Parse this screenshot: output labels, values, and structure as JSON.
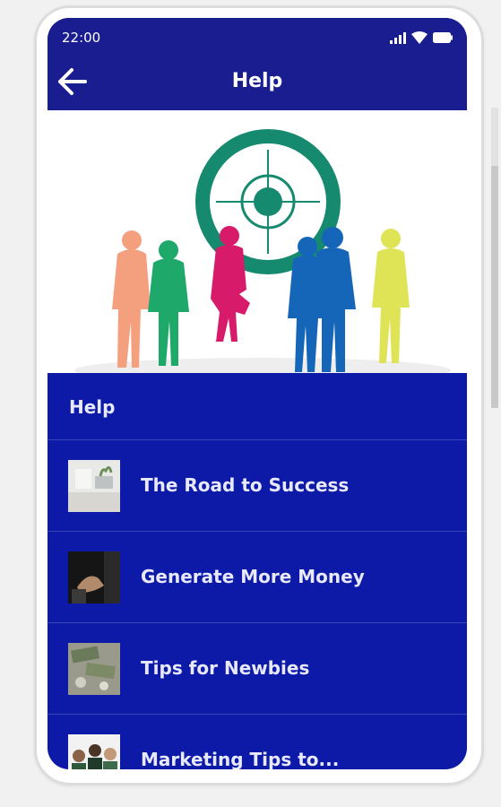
{
  "status_bar": {
    "time": "22:00",
    "icons": [
      "signal-icon",
      "wifi-icon",
      "battery-icon"
    ]
  },
  "header": {
    "back_icon": "arrow-left-icon",
    "title": "Help"
  },
  "hero_image": {
    "subject": "silhouettes-around-target",
    "colors": {
      "target": "#168a6e",
      "person_1": "#f4a07f",
      "person_2": "#1ea86a",
      "person_3": "#d81a6a",
      "person_4": "#1566b8",
      "person_5": "#dfe356"
    }
  },
  "list": {
    "header": "Help",
    "items": [
      {
        "label": "The Road to Success",
        "thumb": "desk-photo"
      },
      {
        "label": "Generate More Money",
        "thumb": "handshake-photo"
      },
      {
        "label": "Tips for Newbies",
        "thumb": "money-photo"
      },
      {
        "label": "Marketing Tips to...",
        "thumb": "team-photo"
      }
    ]
  },
  "colors": {
    "app_bar": "#1a1d8f",
    "list_background": "#0d1aa8",
    "text": "#e8e9ff"
  }
}
